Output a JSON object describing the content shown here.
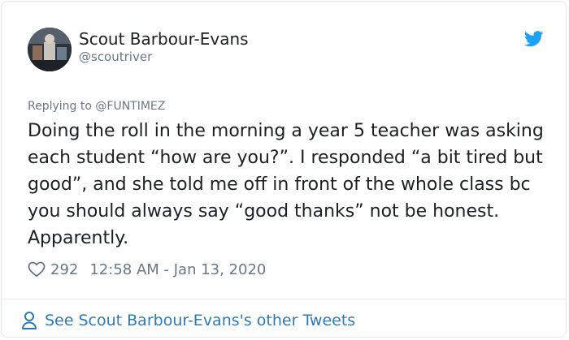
{
  "author": {
    "name": "Scout Barbour-Evans",
    "handle": "@scoutriver"
  },
  "reply": {
    "prefix": "Replying to ",
    "mention": "@FUNTIMEZ"
  },
  "tweet": {
    "text": "Doing the roll in the morning a year 5 teacher was asking each student “how are you?”. I responded “a bit tired but good”, and she told me off in front of the whole class bc you should always say “good thanks” not be honest. Apparently."
  },
  "meta": {
    "likes": "292",
    "timestamp": "12:58 AM - Jan 13, 2020"
  },
  "footer": {
    "link_label": "See Scout Barbour-Evans's other Tweets"
  },
  "icons": {
    "brand": "twitter-bird-icon",
    "like": "heart-icon",
    "profile": "person-icon"
  },
  "colors": {
    "brand_blue": "#1da1f2",
    "link_blue": "#2b7bb9",
    "muted_text": "#697882",
    "body_text": "#1c2022",
    "border": "#e1e8ed"
  }
}
